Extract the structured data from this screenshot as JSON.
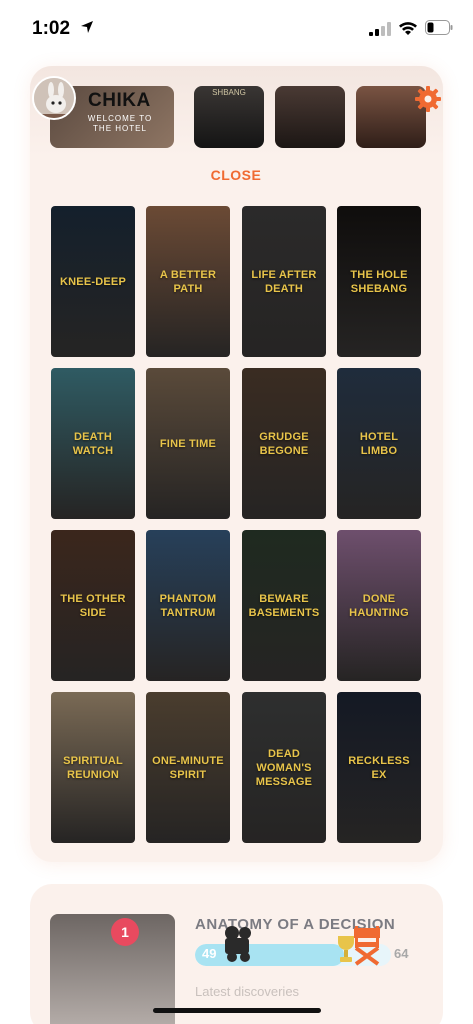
{
  "status_bar": {
    "time": "1:02"
  },
  "profile": {
    "name": "CHIKA",
    "welcome": "WELCOME TO THE HOTEL"
  },
  "header_thumbs": {
    "snippet": "SHBANG"
  },
  "close_label": "CLOSE",
  "episodes": [
    {
      "title": "KNEE-DEEP",
      "bg": "#14202c"
    },
    {
      "title": "A BETTER PATH",
      "bg": "#6b4a35"
    },
    {
      "title": "LIFE AFTER DEATH",
      "bg": "#2b2a2a"
    },
    {
      "title": "THE HOLE SHEBANG",
      "bg": "#0f0d0c"
    },
    {
      "title": "DEATH WATCH",
      "bg": "#2f5b63"
    },
    {
      "title": "FINE TIME",
      "bg": "#5a4a3a"
    },
    {
      "title": "GRUDGE BEGONE",
      "bg": "#3a2c22"
    },
    {
      "title": "HOTEL LIMBO",
      "bg": "#1f2c3c"
    },
    {
      "title": "THE OTHER SIDE",
      "bg": "#3b261c"
    },
    {
      "title": "PHANTOM TANTRUM",
      "bg": "#27405a"
    },
    {
      "title": "BEWARE BASEMENTS",
      "bg": "#1f2a20"
    },
    {
      "title": "DONE HAUNTING",
      "bg": "#6e4f6d"
    },
    {
      "title": "SPIRITUAL REUNION",
      "bg": "#7a6a55"
    },
    {
      "title": "ONE-MINUTE SPIRIT",
      "bg": "#4a3d2e"
    },
    {
      "title": "DEAD WOMAN'S MESSAGE",
      "bg": "#2e2f2f"
    },
    {
      "title": "RECKLESS EX",
      "bg": "#141924"
    }
  ],
  "decision_card": {
    "badge_count": "1",
    "title": "ANATOMY OF A DECISION",
    "progress_start": "49",
    "progress_end": "64",
    "progress_fraction": 0.76,
    "subtitle": "Latest discoveries"
  },
  "colors": {
    "accent": "#f06a32",
    "tile_text": "#e8c44a",
    "panel_bg": "#fbf1ec",
    "badge": "#e84a5f",
    "progress_fill": "#a8e3f2"
  }
}
